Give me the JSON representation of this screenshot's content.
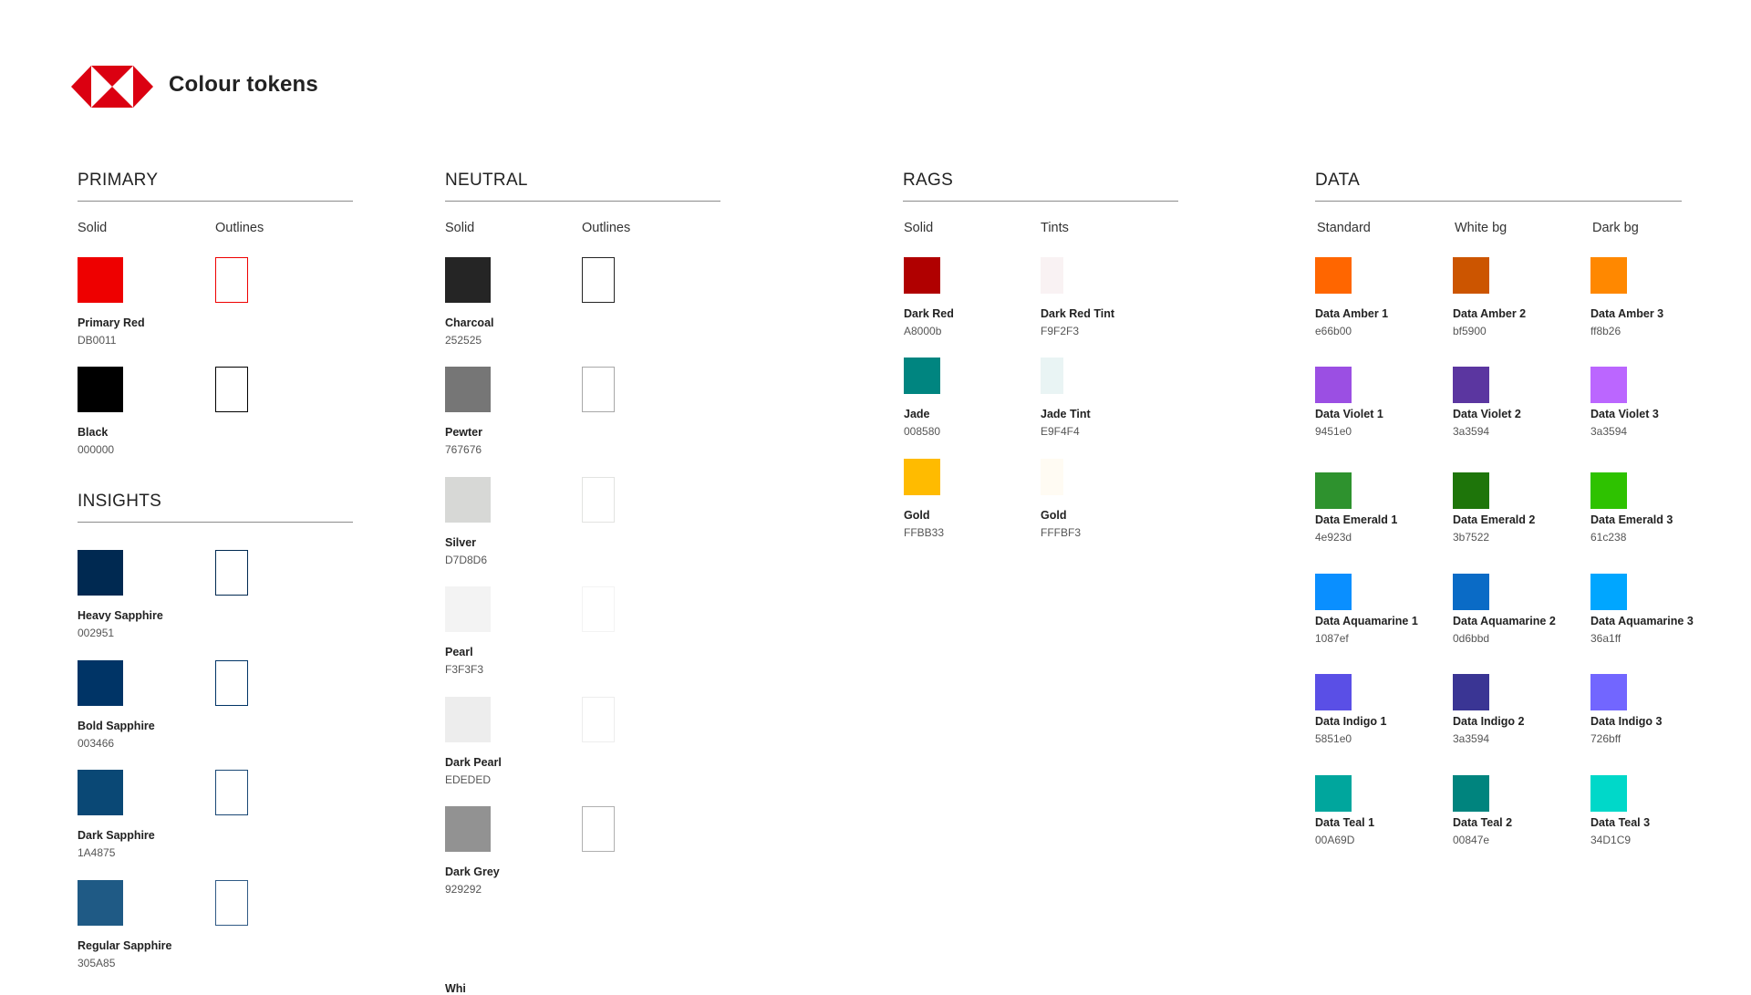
{
  "header": {
    "title": "Colour tokens",
    "logo_colors": {
      "red": "#DB0011",
      "white": "#FFFFFF"
    }
  },
  "sections": {
    "primary": {
      "title": "PRIMARY",
      "col_solid": "Solid",
      "col_outlines": "Outlines",
      "tokens": [
        {
          "name": "Primary Red",
          "hex": "DB0011",
          "color": "#EE0000",
          "outline": "#EE0000"
        },
        {
          "name": "Black",
          "hex": "000000",
          "color": "#000000",
          "outline": "#000000"
        }
      ]
    },
    "insights": {
      "title": "INSIGHTS",
      "tokens": [
        {
          "name": "Heavy Sapphire",
          "hex": "002951",
          "color": "#002951",
          "outline": "#002951"
        },
        {
          "name": "Bold Sapphire",
          "hex": "003466",
          "color": "#003466",
          "outline": "#003466"
        },
        {
          "name": "Dark Sapphire",
          "hex": "1A4875",
          "color": "#0A4875",
          "outline": "#1A4875"
        },
        {
          "name": "Regular Sapphire",
          "hex": "305A85",
          "color": "#1F5A85",
          "outline": "#305A85"
        }
      ]
    },
    "neutral": {
      "title": "NEUTRAL",
      "col_solid": "Solid",
      "col_outlines": "Outlines",
      "tokens": [
        {
          "name": "Charcoal",
          "hex": "252525",
          "color": "#252525",
          "outline": "#252525"
        },
        {
          "name": "Pewter",
          "hex": "767676",
          "color": "#767676",
          "outline": "#A8A8A8"
        },
        {
          "name": "Silver",
          "hex": "D7D8D6",
          "color": "#D7D8D6",
          "outline": "#E2E3E1"
        },
        {
          "name": "Pearl",
          "hex": "F3F3F3",
          "color": "#F3F3F3",
          "outline": "#F3F3F3"
        },
        {
          "name": "Dark Pearl",
          "hex": "EDEDED",
          "color": "#EDEDED",
          "outline": "#EDEDED"
        },
        {
          "name": "Dark Grey",
          "hex": "929292",
          "color": "#929292",
          "outline": "#B0B0B0"
        }
      ]
    },
    "rags": {
      "title": "RAGS",
      "col_solid": "Solid",
      "col_tints": "Tints",
      "solid": [
        {
          "name": "Dark Red",
          "hex": "A8000b",
          "color": "#B00000"
        },
        {
          "name": "Jade",
          "hex": "008580",
          "color": "#008580"
        },
        {
          "name": "Gold",
          "hex": "FFBB33",
          "color": "#FFBB00"
        }
      ],
      "tints": [
        {
          "name": "Dark Red Tint",
          "hex": "F9F2F3",
          "color": "#F9F2F3"
        },
        {
          "name": "Jade Tint",
          "hex": "E9F4F4",
          "color": "#E9F4F4"
        },
        {
          "name": "Gold",
          "hex": "FFFBF3",
          "color": "#FFFBF3"
        }
      ]
    },
    "data": {
      "title": "DATA",
      "col_standard": "Standard",
      "col_white_bg": "White bg",
      "col_dark_bg": "Dark bg",
      "rows": [
        [
          {
            "name": "Data Amber 1",
            "hex": "e66b00",
            "color": "#FF6600"
          },
          {
            "name": "Data Amber 2",
            "hex": "bf5900",
            "color": "#CC5500"
          },
          {
            "name": "Data Amber 3",
            "hex": "ff8b26",
            "color": "#FF8800"
          }
        ],
        [
          {
            "name": "Data Violet 1",
            "hex": "9451e0",
            "color": "#9B4FE3"
          },
          {
            "name": "Data Violet 2",
            "hex": "3a3594",
            "color": "#5B36A0"
          },
          {
            "name": "Data Violet 3",
            "hex": "3a3594",
            "color": "#BB66FF"
          }
        ],
        [
          {
            "name": "Data Emerald 1",
            "hex": "4e923d",
            "color": "#2E922E"
          },
          {
            "name": "Data Emerald 2",
            "hex": "3b7522",
            "color": "#1E750A"
          },
          {
            "name": "Data Emerald 3",
            "hex": "61c238",
            "color": "#2EC200"
          }
        ],
        [
          {
            "name": "Data Aquamarine 1",
            "hex": "1087ef",
            "color": "#0A8FFF"
          },
          {
            "name": "Data Aquamarine 2",
            "hex": "0d6bbd",
            "color": "#0A6BC6"
          },
          {
            "name": "Data Aquamarine 3",
            "hex": "36a1ff",
            "color": "#00A6FF"
          }
        ],
        [
          {
            "name": "Data Indigo 1",
            "hex": "5851e0",
            "color": "#5A4FE6"
          },
          {
            "name": "Data Indigo 2",
            "hex": "3a3594",
            "color": "#3A3594"
          },
          {
            "name": "Data Indigo 3",
            "hex": "726bff",
            "color": "#7266FF"
          }
        ],
        [
          {
            "name": "Data Teal 1",
            "hex": "00A69D",
            "color": "#00A69D"
          },
          {
            "name": "Data Teal 2",
            "hex": "00847e",
            "color": "#00847E"
          },
          {
            "name": "Data Teal 3",
            "hex": "34D1C9",
            "color": "#00D8C9"
          }
        ]
      ]
    },
    "truncated_label": "Whi"
  }
}
